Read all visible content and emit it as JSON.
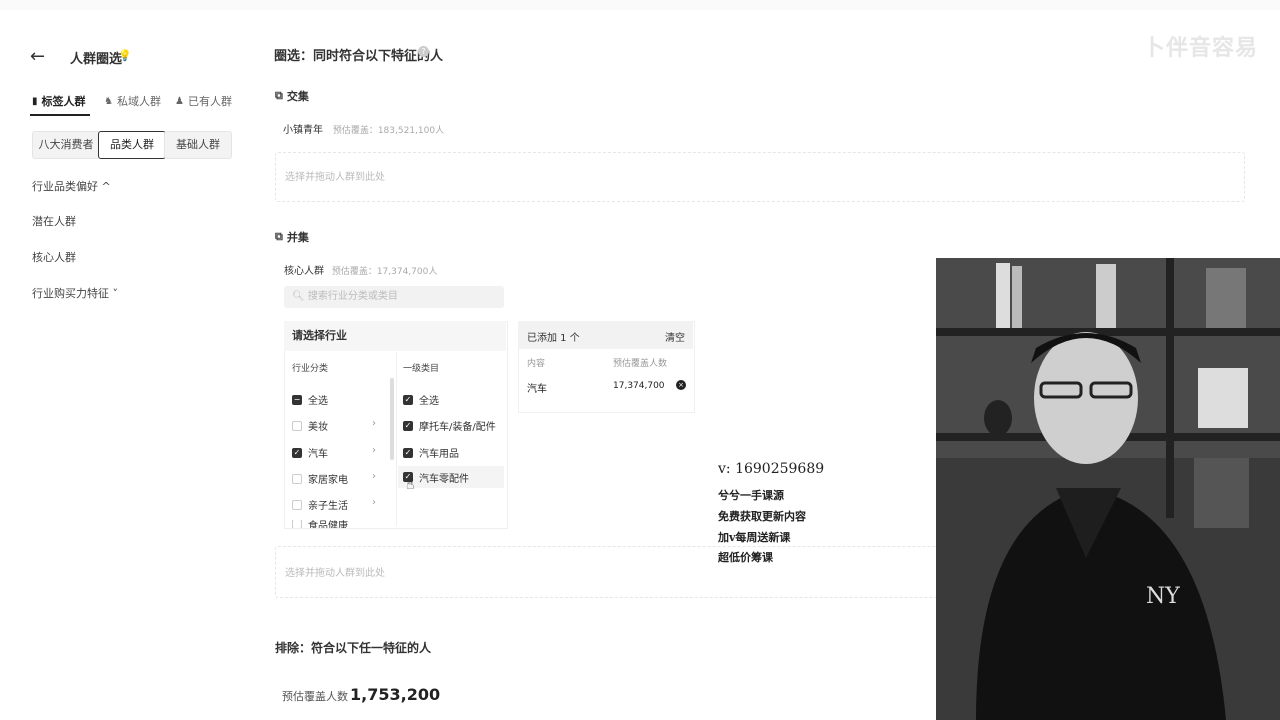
{
  "watermark": "卜伴音容易",
  "left": {
    "title": "人群圈选",
    "tabs": [
      {
        "label": "标签人群",
        "icon": "tag-icon"
      },
      {
        "label": "私域人群",
        "icon": "private-icon"
      },
      {
        "label": "已有人群",
        "icon": "user-icon"
      }
    ],
    "segments": [
      "八大消费者",
      "品类人群",
      "基础人群"
    ],
    "menu": [
      "行业品类偏好 ^",
      "潜在人群",
      "核心人群",
      "行业购买力特征 ˅"
    ]
  },
  "main": {
    "title": "圈选：同时符合以下特征的人",
    "intersection": {
      "label": "交集",
      "group_name": "小镇青年",
      "group_est": "预估覆盖：183,521,100人",
      "dropzone": "选择并拖动人群到此处"
    },
    "union": {
      "label": "并集",
      "group_name": "核心人群",
      "group_est": "预估覆盖：17,374,700人",
      "search_placeholder": "搜索行业分类或类目",
      "panel_title": "请选择行业",
      "col1_header": "行业分类",
      "col2_header": "一级类目",
      "col1_items": [
        {
          "label": "全选",
          "state": "indeterminate"
        },
        {
          "label": "美妆",
          "state": "off",
          "arrow": true
        },
        {
          "label": "汽车",
          "state": "on",
          "arrow": true
        },
        {
          "label": "家居家电",
          "state": "off",
          "arrow": true
        },
        {
          "label": "亲子生活",
          "state": "off",
          "arrow": true
        },
        {
          "label": "食品健康",
          "state": "off",
          "arrow": true
        }
      ],
      "col2_items": [
        {
          "label": "全选",
          "state": "on"
        },
        {
          "label": "摩托车/装备/配件",
          "state": "on"
        },
        {
          "label": "汽车用品",
          "state": "on"
        },
        {
          "label": "汽车零配件",
          "state": "on"
        }
      ],
      "added_title": "已添加 1 个",
      "clear_label": "清空",
      "added_col_content": "内容",
      "added_col_est": "预估覆盖人数",
      "added_rows": [
        {
          "content": "汽车",
          "est": "17,374,700"
        }
      ],
      "dropzone": "选择并拖动人群到此处"
    },
    "exclude_title": "排除：符合以下任一特征的人",
    "est_label": "预估覆盖人数",
    "est_value": "1,753,200"
  },
  "promo": {
    "lines": [
      "v: 1690259689",
      "兮兮一手课源",
      "免费获取更新内容",
      "加v每周送新课",
      "超低价筹课"
    ]
  },
  "colors": {
    "accent": "#222222",
    "bg": "#ffffff",
    "muted": "#999999"
  }
}
